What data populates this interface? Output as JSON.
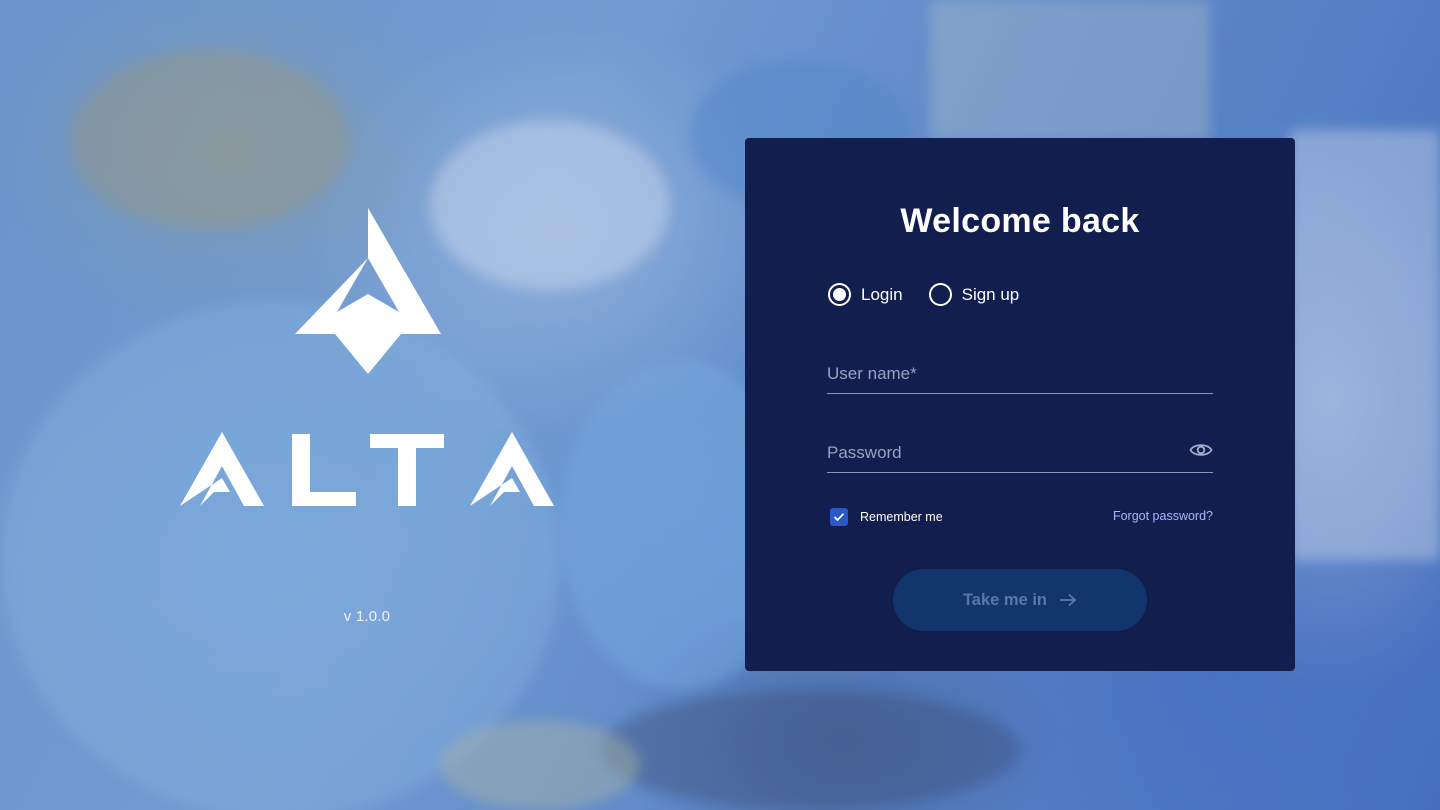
{
  "brand": {
    "logo_icon": "alta-triangle-logo",
    "wordmark": "ALTA",
    "version": "v 1.0.0"
  },
  "card": {
    "title": "Welcome back",
    "modes": [
      {
        "label": "Login",
        "selected": true
      },
      {
        "label": "Sign up",
        "selected": false
      }
    ],
    "username": {
      "placeholder": "User name*",
      "value": ""
    },
    "password": {
      "placeholder": "Password",
      "value": "",
      "toggle_icon": "eye-icon"
    },
    "remember_me": {
      "label": "Remember me",
      "checked": true
    },
    "forgot_password": "Forgot password?",
    "submit": {
      "label": "Take me in",
      "icon": "arrow-right-icon",
      "enabled": false
    }
  },
  "colors": {
    "card_background": "#111e4e",
    "accent": "#2a58c9",
    "link": "#a8b8ff",
    "button_disabled": "#12356b"
  }
}
